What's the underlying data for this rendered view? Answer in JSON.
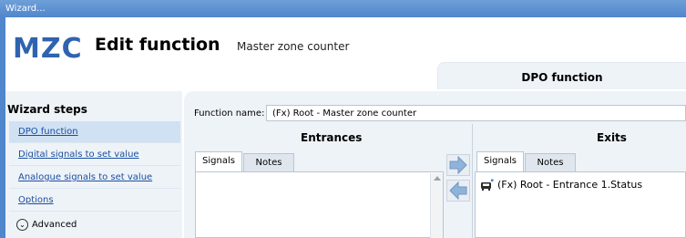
{
  "window": {
    "title": "Wizard..."
  },
  "header": {
    "logo": "MZC",
    "title": "Edit function",
    "subtitle": "Master zone counter",
    "tab_label": "DPO function"
  },
  "sidebar": {
    "header": "Wizard steps",
    "items": [
      {
        "label": "DPO function",
        "active": true
      },
      {
        "label": "Digital signals to set value",
        "active": false
      },
      {
        "label": "Analogue signals to set value",
        "active": false
      },
      {
        "label": "Options",
        "active": false
      }
    ],
    "advanced_label": "Advanced"
  },
  "main": {
    "function_name_label": "Function name:",
    "function_name_value": "(Fx) Root - Master zone counter",
    "entrances": {
      "title": "Entrances",
      "tabs": [
        "Signals",
        "Notes"
      ],
      "items": []
    },
    "exits": {
      "title": "Exits",
      "tabs": [
        "Signals",
        "Notes"
      ],
      "items": [
        "(Fx) Root - Entrance 1.Status"
      ]
    }
  },
  "colors": {
    "accent": "#4f86cc",
    "logo": "#2f63b0",
    "panel": "#eef3f8",
    "arrow": "#8fb3d9"
  },
  "icons": {
    "add": "arrow-right-icon",
    "remove": "arrow-left-icon",
    "exit_item": "car-icon",
    "advanced": "chevron-down-circle-icon"
  }
}
